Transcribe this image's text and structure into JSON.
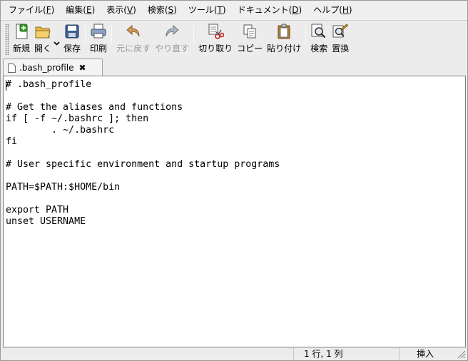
{
  "menubar": {
    "items": [
      {
        "label": "ファイル(",
        "accel": "F",
        "close": ")"
      },
      {
        "label": "編集(",
        "accel": "E",
        "close": ")"
      },
      {
        "label": "表示(",
        "accel": "V",
        "close": ")"
      },
      {
        "label": "検索(",
        "accel": "S",
        "close": ")"
      },
      {
        "label": "ツール(",
        "accel": "T",
        "close": ")"
      },
      {
        "label": "ドキュメント(",
        "accel": "D",
        "close": ")"
      },
      {
        "label": "ヘルプ(",
        "accel": "H",
        "close": ")"
      }
    ]
  },
  "toolbar": {
    "new_label": "新規",
    "open_label": "開く",
    "save_label": "保存",
    "print_label": "印刷",
    "undo_label": "元に戻す",
    "redo_label": "やり直す",
    "cut_label": "切り取り",
    "copy_label": "コピー",
    "paste_label": "貼り付け",
    "find_label": "検索",
    "replace_label": "置換"
  },
  "tab": {
    "label": ".bash_profile",
    "close_glyph": "✖"
  },
  "editor": {
    "content": "# .bash_profile\n\n# Get the aliases and functions\nif [ -f ~/.bashrc ]; then\n        . ~/.bashrc\nfi\n\n# User specific environment and startup programs\n\nPATH=$PATH:$HOME/bin\n\nexport PATH\nunset USERNAME"
  },
  "statusbar": {
    "position": "1 行, 1 列",
    "mode": "挿入"
  },
  "colors": {
    "window_bg": "#ececec",
    "editor_bg": "#ffffff",
    "disabled_text": "#9a9a9a"
  }
}
